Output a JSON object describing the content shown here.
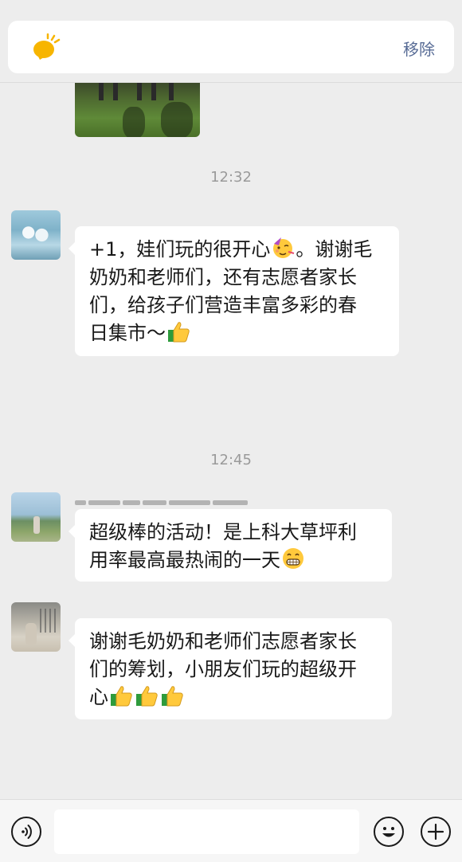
{
  "notice": {
    "remove_label": "移除",
    "icon": "bulb-icon",
    "icon_color": "#f7b500"
  },
  "messages": [
    {
      "time": "12:32",
      "lines": [
        "+1，娃们玩的很开心",
        "。谢谢毛",
        "奶奶和老师们，还有志愿者家长",
        "们，给孩子们营造丰富多彩的春",
        "日集市～"
      ],
      "emojis": [
        "party-face-emoji",
        "thumbs-up-emoji"
      ]
    },
    {
      "time": "12:45",
      "lines": [
        "超级棒的活动！是上科大草坪利",
        "用率最高最热闹的一天"
      ],
      "emojis": [
        "grin-emoji"
      ]
    },
    {
      "lines": [
        "谢谢毛奶奶和老师们志愿者家长",
        "们的筹划，小朋友们玩的超级开",
        "心"
      ],
      "emojis": [
        "thumbs-up-emoji",
        "thumbs-up-emoji",
        "thumbs-up-emoji"
      ]
    }
  ],
  "input": {
    "value": "",
    "voice_icon": "voice-icon",
    "emoji_icon": "emoji-icon",
    "plus_icon": "plus-icon"
  },
  "colors": {
    "background": "#ededed",
    "bubble": "#ffffff",
    "link": "#576b95",
    "timestamp": "#9a9a9a"
  }
}
